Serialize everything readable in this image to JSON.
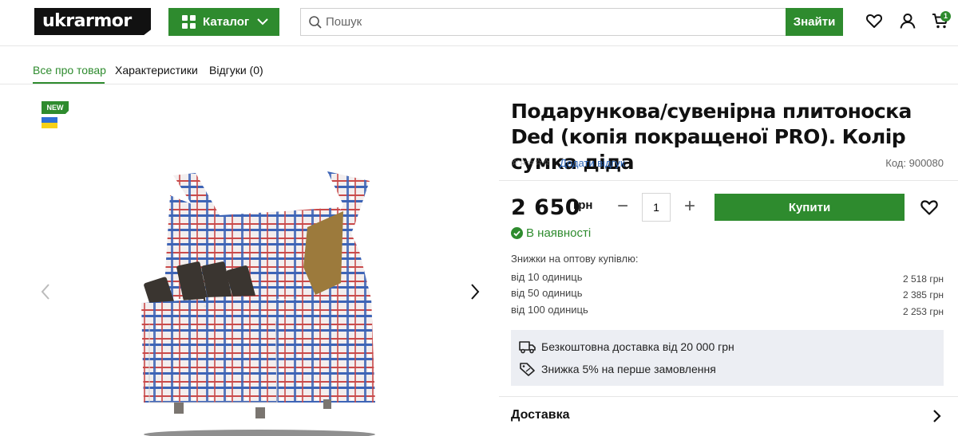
{
  "header": {
    "logo": "ukrarmor",
    "catalog_label": "Каталог",
    "search_placeholder": "Пошук",
    "search_button": "Знайти",
    "cart_count": "1",
    "accent": "#2e8b2e"
  },
  "tabs": [
    {
      "label": "Все про товар",
      "active": true
    },
    {
      "label": "Характеристики",
      "active": false
    },
    {
      "label": "Відгуки (0)",
      "active": false
    }
  ],
  "gallery": {
    "badge": "NEW"
  },
  "product": {
    "title": "Подарункова/сувенірна плитоноска Ded (копія покращеної PRO). Колір сумка діда",
    "rating_stars": "☆☆☆☆☆",
    "add_review": "Додати відгук",
    "sku": "Код: 900080",
    "price": "2 650",
    "currency": "грн",
    "quantity": "1",
    "buy_label": "Купити",
    "stock": "В наявності",
    "wholesale_title": "Знижки на оптову купівлю:",
    "wholesale": [
      {
        "qty": "від 10 одиниць",
        "price": "2 518 грн"
      },
      {
        "qty": "від 50 одиниць",
        "price": "2 385 грн"
      },
      {
        "qty": "від 100 одиниць",
        "price": "2 253 грн"
      }
    ],
    "perks": [
      {
        "icon": "truck-icon",
        "text": "Безкоштовна доставка від 20 000 грн"
      },
      {
        "icon": "discount-tag-icon",
        "text": "Знижка 5% на перше замовлення"
      }
    ],
    "delivery_label": "Доставка"
  }
}
